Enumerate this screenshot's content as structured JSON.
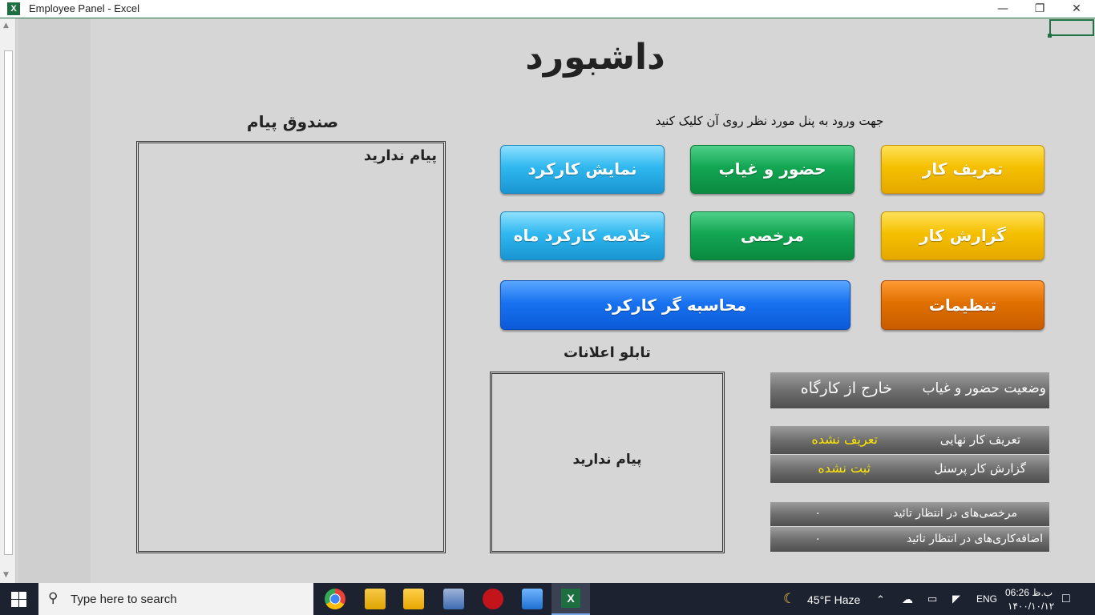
{
  "window": {
    "title": "Employee Panel - Excel",
    "app_icon": "X",
    "controls": [
      "minimize-icon",
      "restore-icon",
      "close-icon"
    ]
  },
  "dashboard": {
    "heading": "داشبورد",
    "instruction": "جهت ورود به پنل مورد نظر روی آن کلیک کنید",
    "buttons": {
      "task_definition": "تعریف کار",
      "attendance": "حضور و غیاب",
      "work_display": "نمایش کارکرد",
      "work_report": "گزارش کار",
      "leave": "مرخصی",
      "monthly_summary": "خلاصه کارکرد ماه",
      "settings": "تنظیمات",
      "work_calculator": "محاسبه گر کارکرد"
    },
    "colors": {
      "yellow": "#f5c000",
      "green": "#13a653",
      "cyan": "#2fb8ef",
      "orange": "#e07000",
      "blue": "#1872f0"
    }
  },
  "inbox": {
    "title": "صندوق پیام",
    "message": "پیام ندارید"
  },
  "noticeboard": {
    "title": "تابلو اعلانات",
    "message": "پیام ندارید"
  },
  "status": {
    "attendance_label": "وضعیت حضور و غیاب",
    "attendance_value": "خارج از کارگاه",
    "final_task_label": "تعریف کار نهایی",
    "final_task_value": "تعریف نشده",
    "personnel_report_label": "گزارش کار پرسنل",
    "personnel_report_value": "ثبت نشده",
    "pending_leave_label": "مرخصی‌های در انتظار تائید",
    "pending_leave_value": "۰",
    "pending_overtime_label": "اضافه‌کاری‌های در انتظار تائید",
    "pending_overtime_value": "۰",
    "highlight_color": "#ffe600"
  },
  "taskbar": {
    "search_placeholder": "Type here to search",
    "weather": "45°F  Haze",
    "language": "ENG",
    "time": "06:26 ب.ظ",
    "date": "۱۴۰۰/۱۰/۱۲",
    "pinned_icons": [
      "chrome-icon",
      "file-explorer-icon",
      "folder-icon",
      "network-app-icon",
      "red-app-icon",
      "photos-icon",
      "excel-icon"
    ]
  }
}
